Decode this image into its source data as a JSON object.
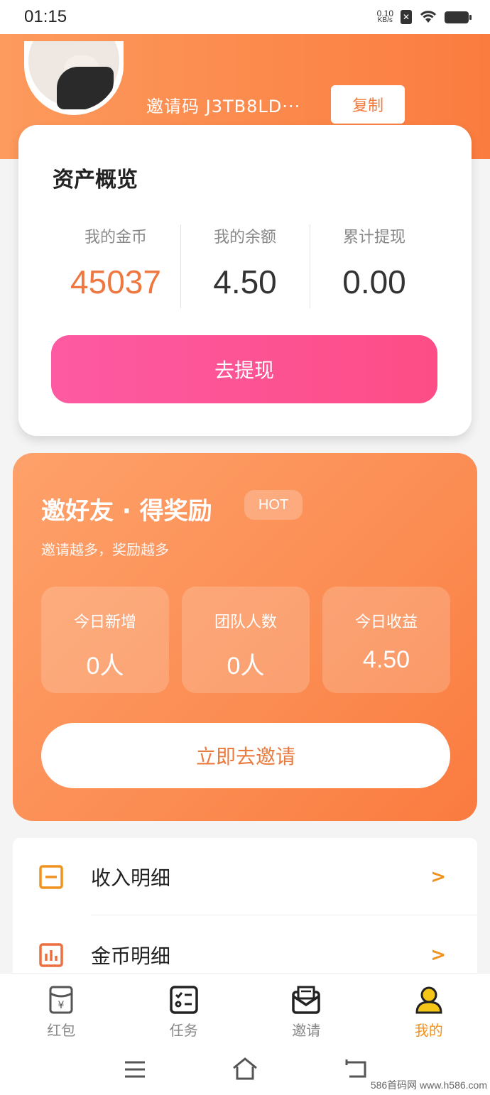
{
  "status_bar": {
    "time": "01:15",
    "net_speed_value": "0.10",
    "net_speed_unit": "KB/s",
    "sim_label": "✕"
  },
  "header": {
    "invite_code": "邀请码 J3TB8LD···",
    "copy_label": "复制"
  },
  "assets": {
    "title": "资产概览",
    "stats": [
      {
        "label": "我的金币",
        "value": "45037"
      },
      {
        "label": "我的余额",
        "value": "4.50"
      },
      {
        "label": "累计提现",
        "value": "0.00"
      }
    ],
    "withdraw_label": "去提现"
  },
  "invite": {
    "title": "邀好友 · 得奖励",
    "badge": "HOT",
    "subtitle": "邀请越多，奖励越多",
    "stats": [
      {
        "label": "今日新增",
        "value": "0人"
      },
      {
        "label": "团队人数",
        "value": "0人"
      },
      {
        "label": "今日收益",
        "value": "4.50"
      }
    ],
    "button_label": "立即去邀请"
  },
  "menu": {
    "items": [
      {
        "label": "收入明细",
        "icon": "document-icon"
      },
      {
        "label": "金币明细",
        "icon": "bar-chart-icon"
      }
    ],
    "arrow": ">"
  },
  "tabs": [
    {
      "label": "红包",
      "icon": "red-packet-icon",
      "active": false
    },
    {
      "label": "任务",
      "icon": "task-list-icon",
      "active": false
    },
    {
      "label": "邀请",
      "icon": "invite-envelope-icon",
      "active": false
    },
    {
      "label": "我的",
      "icon": "user-icon",
      "active": true
    }
  ],
  "watermark": "586首码网 www.h586.com",
  "colors": {
    "accent": "#f0921e",
    "orange": "#fb7c3f",
    "pink": "#fd4d86"
  }
}
